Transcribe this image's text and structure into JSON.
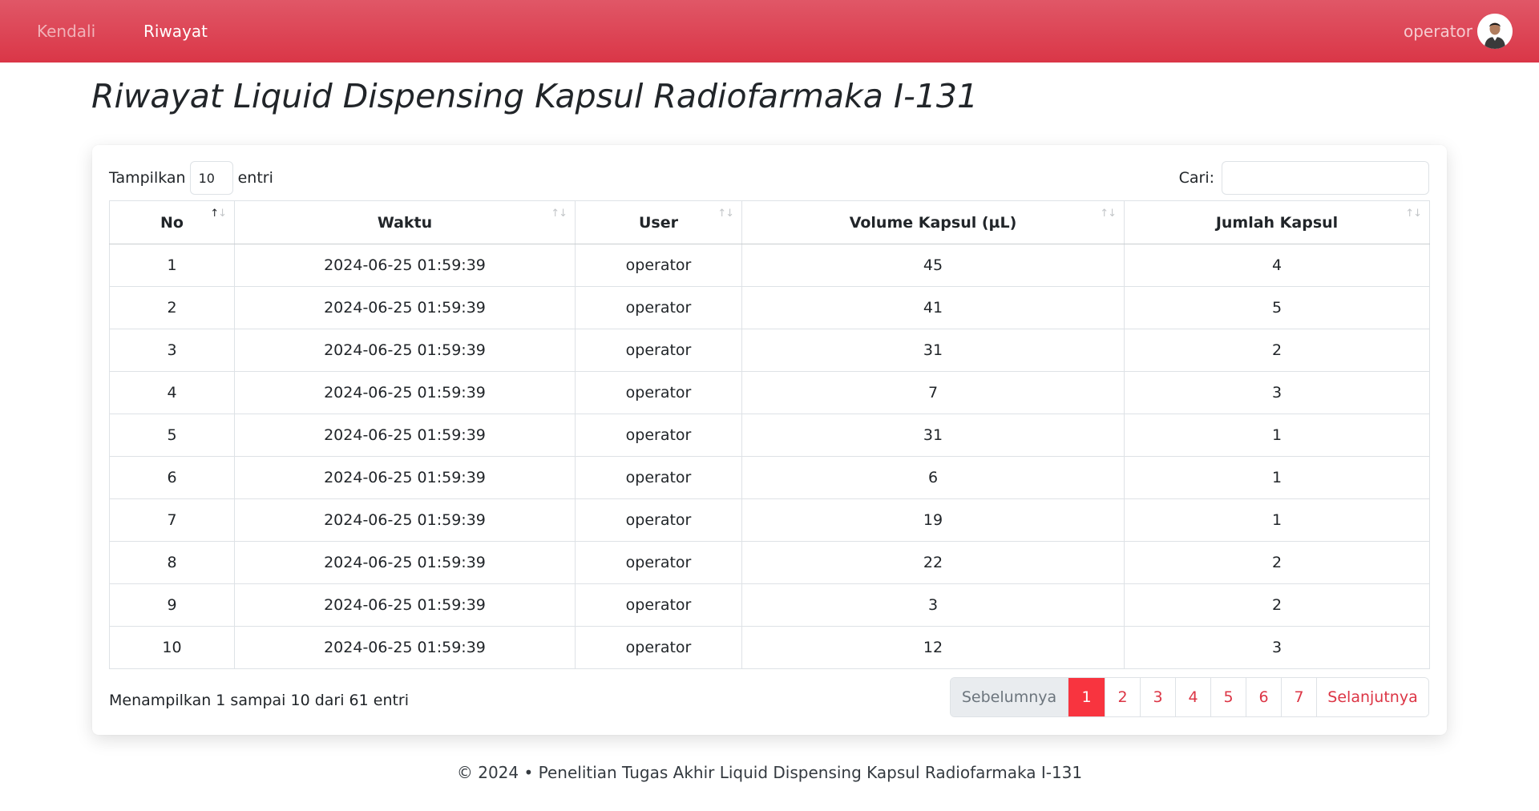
{
  "nav": {
    "items": [
      {
        "label": "Kendali"
      },
      {
        "label": "Riwayat"
      }
    ],
    "user_name": "operator"
  },
  "page_title": "Riwayat Liquid Dispensing Kapsul Radiofarmaka I-131",
  "table_controls": {
    "length_prefix": "Tampilkan",
    "length_value": "10",
    "length_suffix": "entri",
    "search_label": "Cari:",
    "search_value": ""
  },
  "table": {
    "columns": [
      "No",
      "Waktu",
      "User",
      "Volume Kapsul (µL)",
      "Jumlah Kapsul"
    ],
    "rows": [
      [
        "1",
        "2024-06-25 01:59:39",
        "operator",
        "45",
        "4"
      ],
      [
        "2",
        "2024-06-25 01:59:39",
        "operator",
        "41",
        "5"
      ],
      [
        "3",
        "2024-06-25 01:59:39",
        "operator",
        "31",
        "2"
      ],
      [
        "4",
        "2024-06-25 01:59:39",
        "operator",
        "7",
        "3"
      ],
      [
        "5",
        "2024-06-25 01:59:39",
        "operator",
        "31",
        "1"
      ],
      [
        "6",
        "2024-06-25 01:59:39",
        "operator",
        "6",
        "1"
      ],
      [
        "7",
        "2024-06-25 01:59:39",
        "operator",
        "19",
        "1"
      ],
      [
        "8",
        "2024-06-25 01:59:39",
        "operator",
        "22",
        "2"
      ],
      [
        "9",
        "2024-06-25 01:59:39",
        "operator",
        "3",
        "2"
      ],
      [
        "10",
        "2024-06-25 01:59:39",
        "operator",
        "12",
        "3"
      ]
    ]
  },
  "info_text": "Menampilkan 1 sampai 10 dari 61 entri",
  "pagination": {
    "prev_label": "Sebelumnya",
    "pages": [
      "1",
      "2",
      "3",
      "4",
      "5",
      "6",
      "7"
    ],
    "active_page": "1",
    "next_label": "Selanjutnya"
  },
  "footer_text": "© 2024 • Penelitian Tugas Akhir Liquid Dispensing Kapsul Radiofarmaka I-131",
  "colors": {
    "navbar": "#dc3545",
    "accent": "#dc3545",
    "active_page": "#f8343f"
  }
}
